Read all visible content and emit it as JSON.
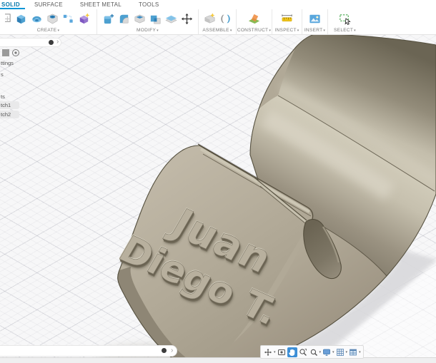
{
  "tabs": [
    {
      "label": "SOLID",
      "active": true
    },
    {
      "label": "SURFACE",
      "active": false
    },
    {
      "label": "SHEET METAL",
      "active": false
    },
    {
      "label": "TOOLS",
      "active": false
    }
  ],
  "ribbon": {
    "groups": [
      {
        "label": "CREATE"
      },
      {
        "label": "MODIFY"
      },
      {
        "label": "ASSEMBLE"
      },
      {
        "label": "CONSTRUCT"
      },
      {
        "label": "INSPECT"
      },
      {
        "label": "INSERT"
      },
      {
        "label": "SELECT"
      }
    ]
  },
  "ui": {
    "caret": "▾",
    "chevron": "›"
  },
  "browser": {
    "fragments": [
      "ttings",
      "s",
      "ts",
      "tch1",
      "tch2"
    ]
  },
  "model": {
    "line1": "Juan",
    "line2": "Diego T.",
    "body_color": "#b1a997",
    "edge_color": "#57503f",
    "highlight_color": "#d8d3c1",
    "dark_band_color": "#6e6857"
  },
  "navbar": {
    "active_tool": "pan"
  },
  "colors": {
    "accent_blue": "#0a96d7",
    "toolbar_bg": "#ffffff",
    "canvas_bg": "#f7f7f8",
    "ground_shadow": "#d9d9dc"
  }
}
